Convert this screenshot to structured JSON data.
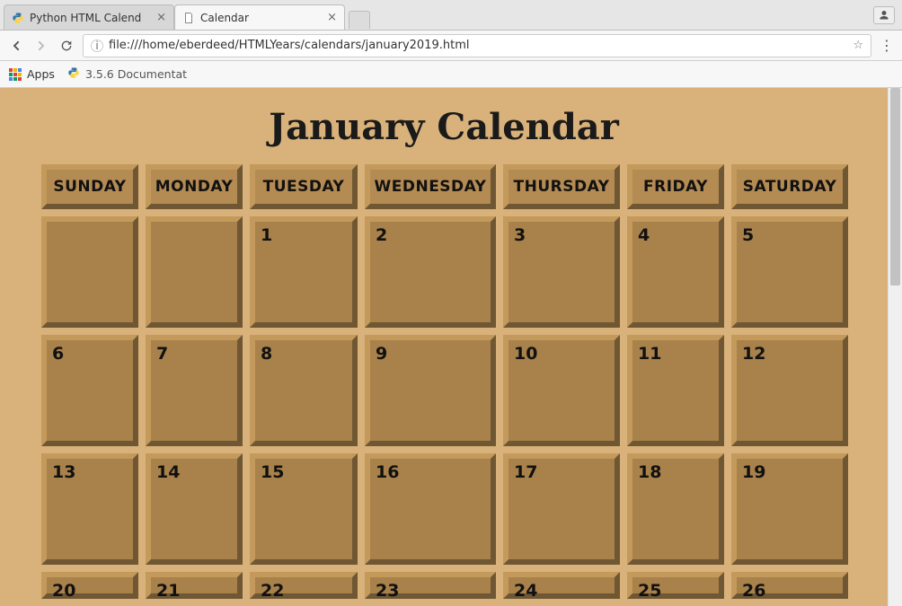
{
  "browser": {
    "tabs": [
      {
        "title": "Python HTML Calend",
        "active": false,
        "favicon": "python"
      },
      {
        "title": "Calendar",
        "active": true,
        "favicon": "page"
      }
    ],
    "url": "file:///home/eberdeed/HTMLYears/calendars/january2019.html",
    "bookmarks": {
      "apps_label": "Apps",
      "items": [
        {
          "title": "3.5.6 Documentat",
          "favicon": "python"
        }
      ]
    }
  },
  "page": {
    "title": "January Calendar",
    "day_headers": [
      "SUNDAY",
      "MONDAY",
      "TUESDAY",
      "WEDNESDAY",
      "THURSDAY",
      "FRIDAY",
      "SATURDAY"
    ],
    "weeks": [
      [
        "",
        "",
        "1",
        "2",
        "3",
        "4",
        "5"
      ],
      [
        "6",
        "7",
        "8",
        "9",
        "10",
        "11",
        "12"
      ],
      [
        "13",
        "14",
        "15",
        "16",
        "17",
        "18",
        "19"
      ],
      [
        "20",
        "21",
        "22",
        "23",
        "24",
        "25",
        "26"
      ]
    ]
  }
}
